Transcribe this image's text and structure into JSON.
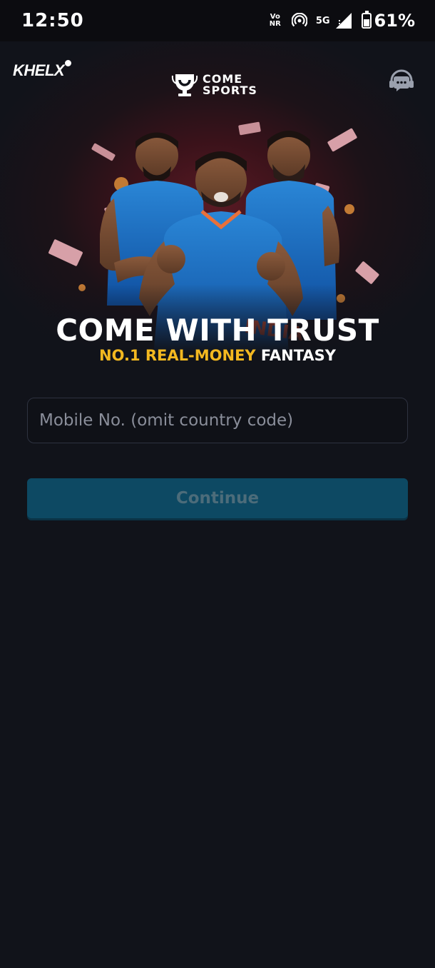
{
  "status_bar": {
    "time": "12:50",
    "volte_top": "Vo",
    "volte_bottom": "NR",
    "network": "5G",
    "battery": "61%",
    "battery_level": 0.61
  },
  "header": {
    "left_logo": "KHELX",
    "brand_line1": "COME",
    "brand_line2": "SPORTS"
  },
  "hero": {
    "headline": "COME WITH TRUST",
    "tagline_highlight": "NO.1 REAL-MONEY",
    "tagline_rest": " FANTASY",
    "jersey_text": "INDIA"
  },
  "form": {
    "mobile_placeholder": "Mobile No. (omit country code)",
    "mobile_value": "",
    "continue_label": "Continue"
  },
  "colors": {
    "background": "#11131a",
    "accent": "#f3b820",
    "button": "#0d4963"
  }
}
